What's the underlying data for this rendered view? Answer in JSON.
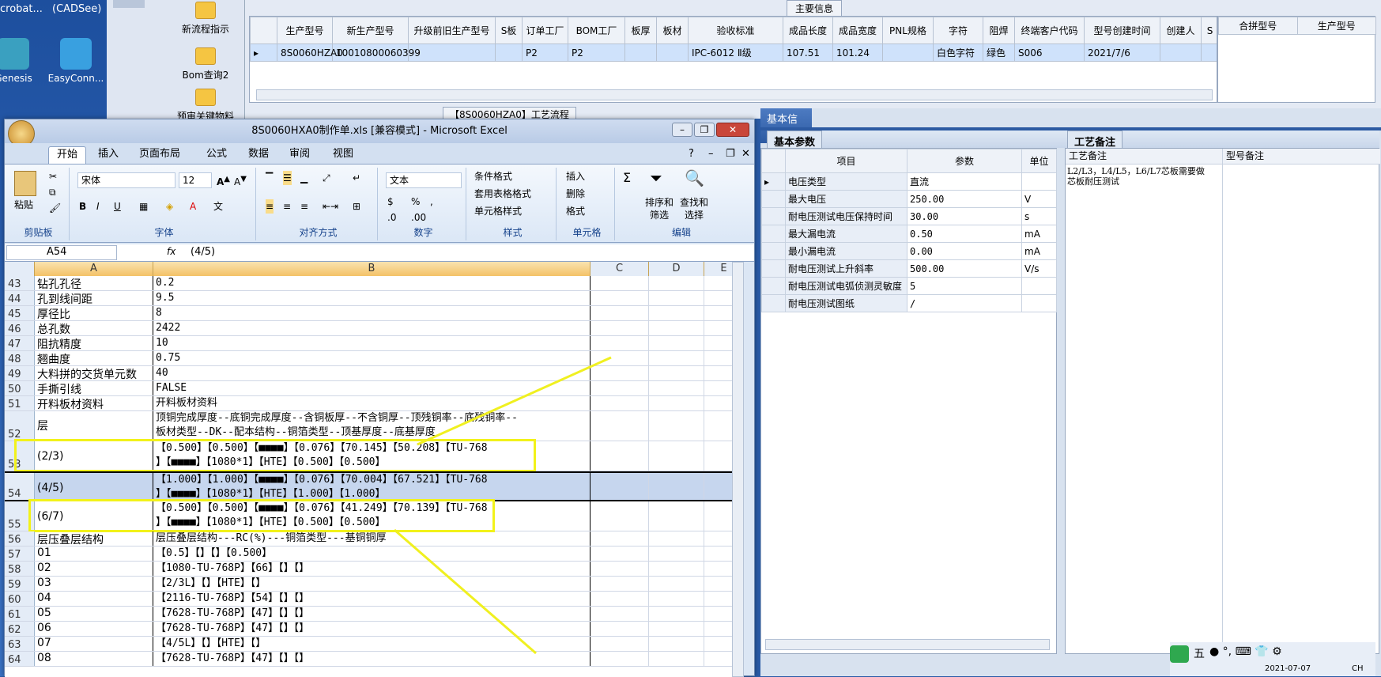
{
  "desktop": {
    "icons": [
      {
        "label": "crobat...",
        "top": "(CADSee)"
      },
      {
        "label": "Genesis"
      },
      {
        "label": "EasyConn..."
      }
    ],
    "top_fragments": [
      "crobat...",
      "(CADSee)"
    ]
  },
  "toolpanel": {
    "items": [
      "新流程指示",
      "Bom查询2",
      "预审关键物料"
    ]
  },
  "main_info": {
    "section_title": "主要信息",
    "columns": [
      "生产型号",
      "新生产型号",
      "升级前旧生产型号",
      "S板",
      "订单工厂",
      "BOM工厂",
      "板厚",
      "板材",
      "验收标准",
      "成品长度",
      "成品宽度",
      "PNL规格",
      "字符",
      "阻焊",
      "终端客户代码",
      "型号创建时间",
      "创建人",
      "S"
    ],
    "row": [
      "8S0060HZA0",
      "10010800060399",
      "",
      "",
      "P2",
      "P2",
      "",
      "",
      "IPC-6012 Ⅱ级",
      "107.51",
      "101.24",
      "",
      "白色字符",
      "绿色",
      "S006",
      "2021/7/6",
      "",
      ""
    ],
    "side_columns": [
      "合拼型号",
      "生产型号"
    ],
    "flow_tab": "【8S0060HZA0】工艺流程"
  },
  "excel": {
    "title": "8S0060HXA0制作单.xls  [兼容模式] - Microsoft Excel",
    "tabs": [
      "开始",
      "插入",
      "页面布局",
      "公式",
      "数据",
      "审阅",
      "视图"
    ],
    "active_tab": "开始",
    "groups": [
      "剪贴板",
      "字体",
      "对齐方式",
      "数字",
      "样式",
      "单元格",
      "编辑"
    ],
    "paste": "粘贴",
    "font_name": "宋体",
    "font_size": "12",
    "number_format": "文本",
    "style_items": [
      "条件格式",
      "套用表格格式",
      "单元格样式"
    ],
    "cell_items": [
      "插入",
      "删除",
      "格式"
    ],
    "edit_items": [
      "排序和筛选",
      "查找和选择"
    ],
    "name_box": "A54",
    "formula": "(4/5)",
    "fx": "fx",
    "col_headers": [
      "A",
      "B",
      "C",
      "D",
      "E"
    ],
    "rows": [
      {
        "n": "43",
        "a": "钻孔孔径",
        "b": "0.2"
      },
      {
        "n": "44",
        "a": "孔到线间距",
        "b": "9.5"
      },
      {
        "n": "45",
        "a": "厚径比",
        "b": "8"
      },
      {
        "n": "46",
        "a": "总孔数",
        "b": "2422"
      },
      {
        "n": "47",
        "a": "阻抗精度",
        "b": "10"
      },
      {
        "n": "48",
        "a": "翘曲度",
        "b": "0.75"
      },
      {
        "n": "49",
        "a": "大料拼的交货单元数",
        "b": "40"
      },
      {
        "n": "50",
        "a": "手撕引线",
        "b": "FALSE"
      },
      {
        "n": "51",
        "a": "开料板材资料",
        "b": "开料板材资料"
      },
      {
        "n": "52",
        "a": "层",
        "b": "顶铜完成厚度--底铜完成厚度--含铜板厚--不含铜厚--顶残铜率--底残铜率--",
        "b2": "板材类型--DK--配本结构--铜箔类型--顶基厚度--底基厚度"
      },
      {
        "n": "53",
        "a": "(2/3)",
        "b": "【0.500】【0.500】【■■■■】【0.076】【70.145】【50.208】【TU-768",
        "b2": "】【■■■■】【1080*1】【HTE】【0.500】【0.500】"
      },
      {
        "n": "54",
        "a": "(4/5)",
        "b": "【1.000】【1.000】【■■■■】【0.076】【70.004】【67.521】【TU-768",
        "b2": "】【■■■■】【1080*1】【HTE】【1.000】【1.000】"
      },
      {
        "n": "55",
        "a": "(6/7)",
        "b": "【0.500】【0.500】【■■■■】【0.076】【41.249】【70.139】【TU-768",
        "b2": "】【■■■■】【1080*1】【HTE】【0.500】【0.500】"
      },
      {
        "n": "56",
        "a": "层压叠层结构",
        "b": "层压叠层结构---RC(%)---铜箔类型---基铜铜厚"
      },
      {
        "n": "57",
        "a": "01",
        "b": "【0.5】【】【】【0.500】"
      },
      {
        "n": "58",
        "a": "02",
        "b": "【1080-TU-768P】【66】【】【】"
      },
      {
        "n": "59",
        "a": "03",
        "b": "【2/3L】【】【HTE】【】"
      },
      {
        "n": "60",
        "a": "04",
        "b": "【2116-TU-768P】【54】【】【】"
      },
      {
        "n": "61",
        "a": "05",
        "b": "【7628-TU-768P】【47】【】【】"
      },
      {
        "n": "62",
        "a": "06",
        "b": "【7628-TU-768P】【47】【】【】"
      },
      {
        "n": "63",
        "a": "07",
        "b": "【4/5L】【】【HTE】【】"
      },
      {
        "n": "64",
        "a": "08",
        "b": "【7628-TU-768P】【47】【】【】"
      }
    ]
  },
  "right": {
    "basic_info": "基本信息",
    "basic_params_tab": "基本参数",
    "craft_note_tab": "工艺备注",
    "params_headers": [
      "项目",
      "参数",
      "单位"
    ],
    "params": [
      {
        "k": "电压类型",
        "v": "直流",
        "u": ""
      },
      {
        "k": "最大电压",
        "v": "250.00",
        "u": "V"
      },
      {
        "k": "耐电压测试电压保持时间",
        "v": "30.00",
        "u": "s"
      },
      {
        "k": "最大漏电流",
        "v": "0.50",
        "u": "mA"
      },
      {
        "k": "最小漏电流",
        "v": "0.00",
        "u": "mA"
      },
      {
        "k": "耐电压测试上升斜率",
        "v": "500.00",
        "u": "V/s"
      },
      {
        "k": "耐电压测试电弧侦测灵敏度",
        "v": "5",
        "u": ""
      },
      {
        "k": "耐电压测试图纸",
        "v": "/",
        "u": ""
      }
    ],
    "note_headers": [
      "工艺备注",
      "型号备注"
    ],
    "note_text": "L2/L3，L4/L5，L6/L7芯板需要做芯板耐压测试"
  },
  "taskbar": {
    "ime": "五",
    "date": "2021-07-07",
    "lang": "CH"
  }
}
